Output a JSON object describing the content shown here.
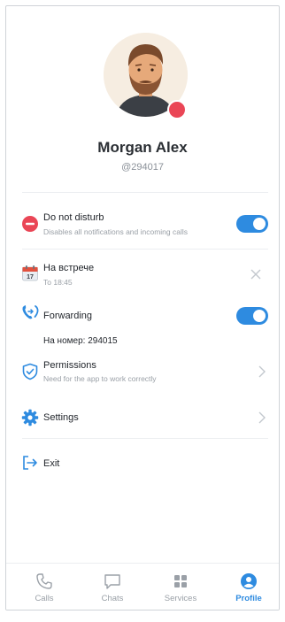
{
  "profile": {
    "name": "Morgan Alex",
    "handle": "@294017",
    "status_color": "#ea4656"
  },
  "items": {
    "dnd": {
      "title": "Do not disturb",
      "subtitle": "Disables all notifications and incoming calls",
      "enabled": true,
      "icon": "minus-circle-icon"
    },
    "meeting": {
      "title": "На встрече",
      "subtitle": "To 18:45",
      "icon": "calendar-icon",
      "calendar_day": "17"
    },
    "forwarding": {
      "title": "Forwarding",
      "number_line": "На номер: 294015",
      "enabled": true,
      "icon": "forward-call-icon"
    },
    "permissions": {
      "title": "Permissions",
      "subtitle": "Need for the app to work correctly",
      "icon": "shield-check-icon"
    },
    "settings": {
      "title": "Settings",
      "icon": "gear-icon"
    },
    "exit": {
      "title": "Exit",
      "icon": "logout-icon"
    }
  },
  "tabs": [
    {
      "label": "Calls",
      "icon": "phone-icon",
      "active": false
    },
    {
      "label": "Chats",
      "icon": "chat-icon",
      "active": false
    },
    {
      "label": "Services",
      "icon": "grid-icon",
      "active": false
    },
    {
      "label": "Profile",
      "icon": "person-icon",
      "active": true
    }
  ],
  "colors": {
    "accent": "#2e8be0",
    "danger": "#ea4656"
  }
}
